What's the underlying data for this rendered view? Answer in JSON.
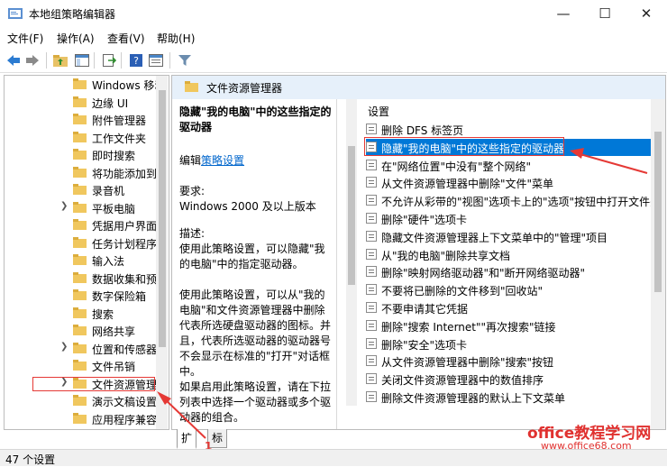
{
  "window": {
    "title": "本地组策略编辑器",
    "minimize": "—",
    "maximize": "☐",
    "close": "✕"
  },
  "menu": [
    "文件(F)",
    "操作(A)",
    "查看(V)",
    "帮助(H)"
  ],
  "toolbar": {
    "icons": [
      "back-arrow-icon",
      "forward-arrow-icon",
      "up-folder-icon",
      "show-hide-tree-icon",
      "export-list-icon",
      "help-icon",
      "properties-icon",
      "filter-icon"
    ]
  },
  "tree": {
    "items": [
      {
        "label": "Windows 移动",
        "expandable": false
      },
      {
        "label": "边缘 UI",
        "expandable": false
      },
      {
        "label": "附件管理器",
        "expandable": false
      },
      {
        "label": "工作文件夹",
        "expandable": false
      },
      {
        "label": "即时搜索",
        "expandable": false
      },
      {
        "label": "将功能添加到",
        "expandable": false
      },
      {
        "label": "录音机",
        "expandable": false
      },
      {
        "label": "平板电脑",
        "expandable": true
      },
      {
        "label": "凭据用户界面",
        "expandable": false
      },
      {
        "label": "任务计划程序",
        "expandable": false
      },
      {
        "label": "输入法",
        "expandable": false
      },
      {
        "label": "数据收集和预",
        "expandable": false
      },
      {
        "label": "数字保险箱",
        "expandable": false
      },
      {
        "label": "搜索",
        "expandable": false
      },
      {
        "label": "网络共享",
        "expandable": false
      },
      {
        "label": "位置和传感器",
        "expandable": true
      },
      {
        "label": "文件吊销",
        "expandable": false
      },
      {
        "label": "文件资源管理",
        "expandable": true
      },
      {
        "label": "演示文稿设置",
        "expandable": false
      },
      {
        "label": "应用程序兼容",
        "expandable": false
      }
    ]
  },
  "pane": {
    "header": "文件资源管理器",
    "settings_header": "设置"
  },
  "description": {
    "title": "隐藏\"我的电脑\"中的这些指定的驱动器",
    "edit_prefix": "编辑",
    "edit_link": "策略设置",
    "requirement_label": "要求:",
    "requirement_value": "Windows 2000 及以上版本",
    "desc_label": "描述:",
    "desc_para1": "使用此策略设置，可以隐藏\"我的电脑\"中的指定驱动器。",
    "desc_para2": "使用此策略设置，可以从\"我的电脑\"和文件资源管理器中删除代表所选硬盘驱动器的图标。并且，代表所选驱动器的驱动器号不会显示在标准的\"打开\"对话框中。",
    "desc_para3": "如果启用此策略设置，请在下拉列表中选择一个驱动器或多个驱动器的组合。"
  },
  "settings": [
    "删除 DFS 标签页",
    "隐藏\"我的电脑\"中的这些指定的驱动器",
    "在\"网络位置\"中没有\"整个网络\"",
    "从文件资源管理器中删除\"文件\"菜单",
    "不允许从彩带的\"视图\"选项卡上的\"选项\"按钮中打开文件夹",
    "删除\"硬件\"选项卡",
    "隐藏文件资源管理器上下文菜单中的\"管理\"项目",
    "从\"我的电脑\"删除共享文档",
    "删除\"映射网络驱动器\"和\"断开网络驱动器\"",
    "不要将已删除的文件移到\"回收站\"",
    "不要申请其它凭据",
    "删除\"搜索 Internet\"\"再次搜索\"链接",
    "删除\"安全\"选项卡",
    "从文件资源管理器中删除\"搜索\"按钮",
    "关闭文件资源管理器中的数值排序",
    "删除文件资源管理器的默认上下文菜单"
  ],
  "selected_setting_index": 1,
  "tabs": [
    "扩展",
    "标准"
  ],
  "status": "47 个设置",
  "annotation": {
    "number": "1",
    "watermark_main": "office教程学习网",
    "watermark_url": "www.office68.com",
    "color": "#e53935"
  },
  "colors": {
    "selection": "#0078d7",
    "link": "#0066cc",
    "header_bg": "#e6f0fa"
  }
}
